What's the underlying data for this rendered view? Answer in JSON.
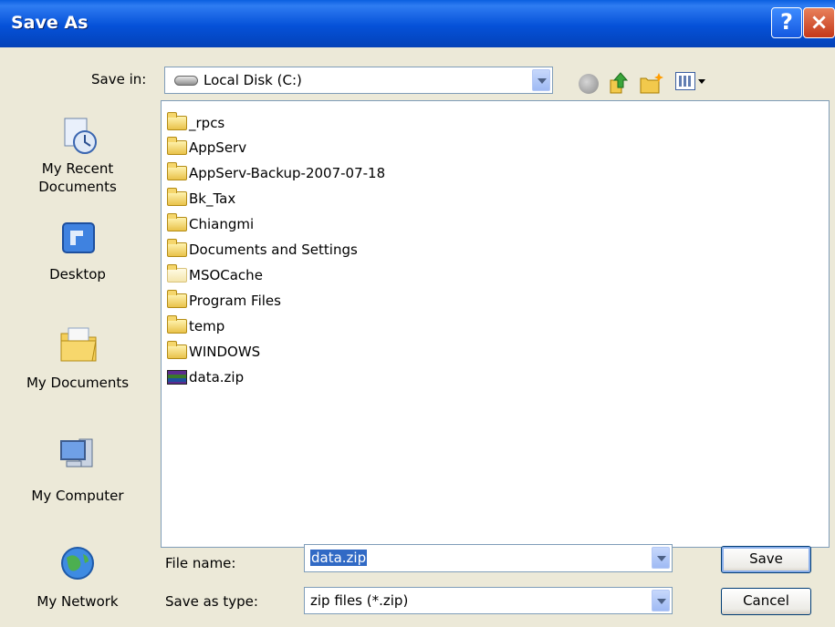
{
  "window": {
    "title": "Save As",
    "help_label": "?",
    "close_label": "×"
  },
  "save_in": {
    "label": "Save in:",
    "value": "Local Disk (C:)"
  },
  "places": [
    {
      "label_lines": [
        "My Recent",
        "Documents"
      ],
      "icon": "recent-documents-icon"
    },
    {
      "label_lines": [
        "Desktop"
      ],
      "icon": "desktop-icon"
    },
    {
      "label_lines": [
        "My Documents"
      ],
      "icon": "my-documents-icon"
    },
    {
      "label_lines": [
        "My Computer"
      ],
      "icon": "my-computer-icon"
    },
    {
      "label_lines": [
        "My Network"
      ],
      "icon": "my-network-icon"
    }
  ],
  "files": [
    {
      "name": "_rpcs",
      "type": "folder"
    },
    {
      "name": "AppServ",
      "type": "folder"
    },
    {
      "name": "AppServ-Backup-2007-07-18",
      "type": "folder"
    },
    {
      "name": "Bk_Tax",
      "type": "folder"
    },
    {
      "name": "Chiangmi",
      "type": "folder"
    },
    {
      "name": "Documents and Settings",
      "type": "folder"
    },
    {
      "name": "MSOCache",
      "type": "folder"
    },
    {
      "name": "Program Files",
      "type": "folder"
    },
    {
      "name": "temp",
      "type": "folder"
    },
    {
      "name": "WINDOWS",
      "type": "folder"
    },
    {
      "name": "data.zip",
      "type": "zip"
    }
  ],
  "file_name": {
    "label": "File name:",
    "value": "data.zip"
  },
  "save_as_type": {
    "label": "Save as type:",
    "value": "zip files (*.zip)"
  },
  "buttons": {
    "save": "Save",
    "cancel": "Cancel"
  }
}
